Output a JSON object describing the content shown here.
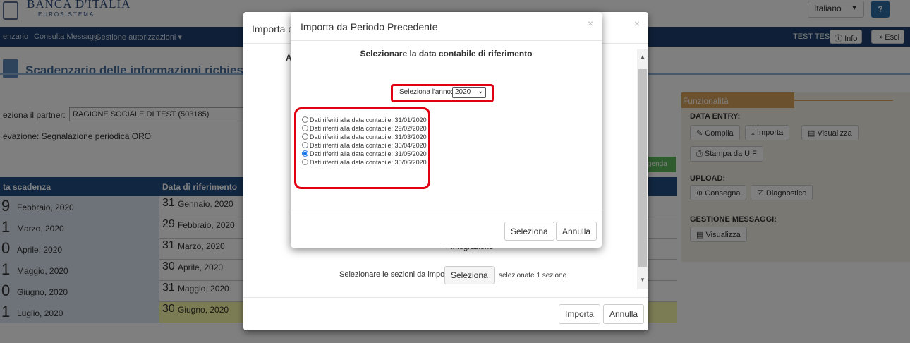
{
  "header": {
    "logo_title": "BANCA D'ITALIA",
    "logo_subtitle": "EUROSISTEMA",
    "language": "Italiano",
    "help_label": "?"
  },
  "navbar": {
    "items": [
      "enzario",
      "Consulta Messaggi",
      "Gestione autorizzazioni ▾"
    ],
    "user": "TEST TEST",
    "info_label": "Info",
    "exit_label": "Esci"
  },
  "page": {
    "title": "Scadenzario delle informazioni richieste per rilev",
    "partner_label": "eziona il partner:",
    "partner_value": "RAGIONE SOCIALE DI TEST (503185)",
    "rilevazione": "evazione: Segnalazione periodica ORO",
    "legenda_label": "genda"
  },
  "table": {
    "headers": [
      "ta scadenza",
      "Data di riferimento"
    ],
    "rows": [
      {
        "due_day": "9",
        "due": "Febbraio, 2020",
        "ref_day": "31",
        "ref": "Gennaio, 2020"
      },
      {
        "due_day": "1",
        "due": "Marzo, 2020",
        "ref_day": "29",
        "ref": "Febbraio, 2020"
      },
      {
        "due_day": "0",
        "due": "Aprile, 2020",
        "ref_day": "31",
        "ref": "Marzo, 2020"
      },
      {
        "due_day": "1",
        "due": "Maggio, 2020",
        "ref_day": "30",
        "ref": "Aprile, 2020"
      },
      {
        "due_day": "0",
        "due": "Giugno, 2020",
        "ref_day": "31",
        "ref": "Maggio, 2020"
      },
      {
        "due_day": "1",
        "due": "Luglio, 2020",
        "ref_day": "30",
        "ref": "Giugno, 2020"
      }
    ]
  },
  "funzionalita": {
    "title": "Funzionalità",
    "data_entry": "DATA ENTRY:",
    "compila": "Compila",
    "importa": "Importa",
    "visualizza": "Visualizza",
    "stampa": "Stampa da UIF",
    "upload": "UPLOAD:",
    "consegna": "Consegna",
    "diagnostico": "Diagnostico",
    "gestione": "GESTIONE MESSAGGI:",
    "visualizza2": "Visualizza"
  },
  "outer_modal": {
    "title": "Importa d",
    "a_label": "A",
    "integrazione": "Integrazione",
    "sezioni_label": "Selezionare le sezioni da importare:",
    "sezioni_button": "Seleziona",
    "sezioni_count": "selezionate 1 sezione",
    "importa_button": "Importa",
    "annulla_button": "Annulla",
    "close": "×"
  },
  "inner_modal": {
    "title": "Importa da Periodo Precedente",
    "close": "×",
    "heading": "Selezionare la data contabile di riferimento",
    "year_label": "Seleziona l'anno:",
    "year_value": "2020",
    "options": [
      {
        "label": "Dati riferiti alla data contabile: 31/01/2020",
        "checked": false
      },
      {
        "label": "Dati riferiti alla data contabile: 29/02/2020",
        "checked": false
      },
      {
        "label": "Dati riferiti alla data contabile: 31/03/2020",
        "checked": false
      },
      {
        "label": "Dati riferiti alla data contabile: 30/04/2020",
        "checked": false
      },
      {
        "label": "Dati riferiti alla data contabile: 31/05/2020",
        "checked": true
      },
      {
        "label": "Dati riferiti alla data contabile: 30/06/2020",
        "checked": false
      }
    ],
    "seleziona_button": "Seleziona",
    "annulla_button": "Annulla"
  },
  "colors": {
    "navbar": "#1c3f6e",
    "table_header": "#234c80",
    "highlight": "#e00012",
    "funzionalita_header": "#d8a35c"
  }
}
